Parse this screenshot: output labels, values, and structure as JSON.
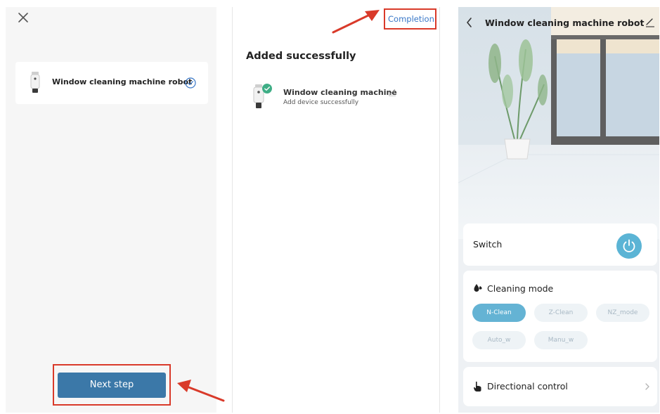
{
  "panel_add_device": {
    "close_icon": "close-icon",
    "device": {
      "name": "Window cleaning machine robot",
      "icon": "robot-device-icon",
      "selected_icon": "check-circle-icon"
    },
    "next_button": "Next step"
  },
  "panel_success": {
    "completion": "Completion",
    "title": "Added successfully",
    "device": {
      "name": "Window cleaning machine",
      "subtitle": "Add device successfully",
      "icon": "robot-device-icon",
      "edit_icon": "pencil-icon"
    }
  },
  "panel_control": {
    "header": {
      "back_icon": "chevron-left-icon",
      "title": "Window cleaning machine robot",
      "edit_icon": "pencil-icon"
    },
    "switch": {
      "label": "Switch",
      "icon": "power-icon"
    },
    "cleaning_mode": {
      "title": "Cleaning mode",
      "icon": "drops-icon",
      "modes": [
        "N-Clean",
        "Z-Clean",
        "NZ_mode",
        "Auto_w",
        "Manu_w"
      ],
      "selected": "N-Clean"
    },
    "directional_control": {
      "label": "Directional control",
      "icon": "hand-pointer-icon"
    }
  },
  "colors": {
    "accent": "#3b78a8",
    "power": "#5bb4d5",
    "chip_active": "#64b3d4",
    "highlight": "#d93a2a",
    "link": "#3a78c8"
  }
}
